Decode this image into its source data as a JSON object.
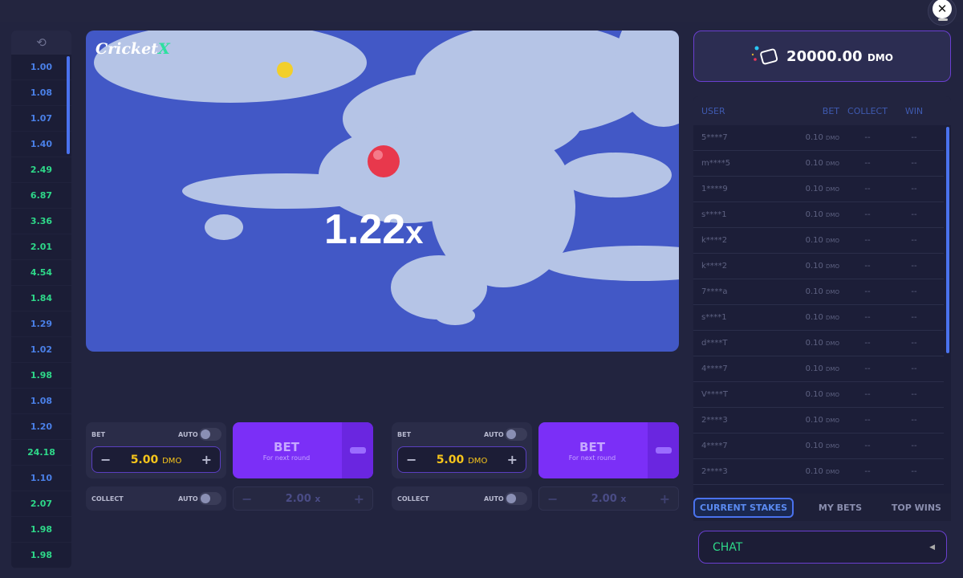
{
  "colors": {
    "accent": "#7b2ff7",
    "low": "#4a80e8",
    "high": "#2ed889",
    "stake": "#f7c51b",
    "link": "#4a72ee"
  },
  "close_icon": "x-icon",
  "history": {
    "icon": "history-icon",
    "items": [
      {
        "v": "1.00",
        "c": "#4a80e8"
      },
      {
        "v": "1.08",
        "c": "#4a80e8"
      },
      {
        "v": "1.07",
        "c": "#4a80e8"
      },
      {
        "v": "1.40",
        "c": "#4a80e8"
      },
      {
        "v": "2.49",
        "c": "#2ed889"
      },
      {
        "v": "6.87",
        "c": "#2ed889"
      },
      {
        "v": "3.36",
        "c": "#2ed889"
      },
      {
        "v": "2.01",
        "c": "#2ed889"
      },
      {
        "v": "4.54",
        "c": "#2ed889"
      },
      {
        "v": "1.84",
        "c": "#2ed889"
      },
      {
        "v": "1.29",
        "c": "#4a80e8"
      },
      {
        "v": "1.02",
        "c": "#4a80e8"
      },
      {
        "v": "1.98",
        "c": "#2ed889"
      },
      {
        "v": "1.08",
        "c": "#4a80e8"
      },
      {
        "v": "1.20",
        "c": "#4a80e8"
      },
      {
        "v": "24.18",
        "c": "#2ed889"
      },
      {
        "v": "1.10",
        "c": "#4a80e8"
      },
      {
        "v": "2.07",
        "c": "#2ed889"
      },
      {
        "v": "1.98",
        "c": "#2ed889"
      },
      {
        "v": "1.98",
        "c": "#2ed889"
      }
    ]
  },
  "game": {
    "logo": "Cricket X",
    "multiplier": "1.22",
    "suffix": "x"
  },
  "bets": [
    {
      "bet_label": "BET",
      "auto_label": "AUTO",
      "amount": "5.00",
      "currency": "DMO",
      "button": "BET",
      "button_sub": "For next round",
      "collect_label": "COLLECT",
      "collect_auto_label": "AUTO",
      "collect_value": "2.00",
      "collect_suffix": "x"
    },
    {
      "bet_label": "BET",
      "auto_label": "AUTO",
      "amount": "5.00",
      "currency": "DMO",
      "button": "BET",
      "button_sub": "For next round",
      "collect_label": "COLLECT",
      "collect_auto_label": "AUTO",
      "collect_value": "2.00",
      "collect_suffix": "x"
    }
  ],
  "balance": {
    "amount": "20000.00",
    "currency": "DMO"
  },
  "table": {
    "headers": [
      "USER",
      "BET",
      "COLLECT",
      "WIN"
    ],
    "rows": [
      [
        "5****7",
        "0.10",
        "DMO",
        "--",
        "--"
      ],
      [
        "m****5",
        "0.10",
        "DMO",
        "--",
        "--"
      ],
      [
        "1****9",
        "0.10",
        "DMO",
        "--",
        "--"
      ],
      [
        "s****1",
        "0.10",
        "DMO",
        "--",
        "--"
      ],
      [
        "k****2",
        "0.10",
        "DMO",
        "--",
        "--"
      ],
      [
        "k****2",
        "0.10",
        "DMO",
        "--",
        "--"
      ],
      [
        "7****a",
        "0.10",
        "DMO",
        "--",
        "--"
      ],
      [
        "s****1",
        "0.10",
        "DMO",
        "--",
        "--"
      ],
      [
        "d****T",
        "0.10",
        "DMO",
        "--",
        "--"
      ],
      [
        "4****7",
        "0.10",
        "DMO",
        "--",
        "--"
      ],
      [
        "V****T",
        "0.10",
        "DMO",
        "--",
        "--"
      ],
      [
        "2****3",
        "0.10",
        "DMO",
        "--",
        "--"
      ],
      [
        "4****7",
        "0.10",
        "DMO",
        "--",
        "--"
      ],
      [
        "2****3",
        "0.10",
        "DMO",
        "--",
        "--"
      ]
    ]
  },
  "tabs": [
    "CURRENT STAKES",
    "MY BETS",
    "TOP WINS"
  ],
  "chat": {
    "label": "CHAT"
  }
}
